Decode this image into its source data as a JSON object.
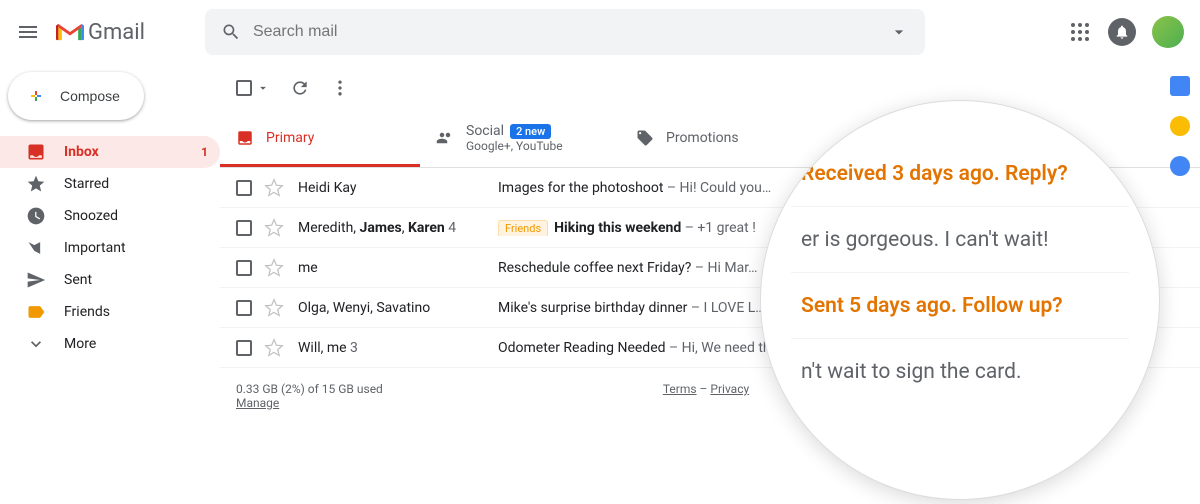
{
  "header": {
    "app_name": "Gmail",
    "search_placeholder": "Search mail"
  },
  "sidebar": {
    "compose_label": "Compose",
    "items": [
      {
        "label": "Inbox",
        "icon": "inbox",
        "active": true,
        "badge": "1"
      },
      {
        "label": "Starred",
        "icon": "star"
      },
      {
        "label": "Snoozed",
        "icon": "clock"
      },
      {
        "label": "Important",
        "icon": "important"
      },
      {
        "label": "Sent",
        "icon": "sent"
      },
      {
        "label": "Friends",
        "icon": "label"
      },
      {
        "label": "More",
        "icon": "more"
      }
    ]
  },
  "tabs": {
    "primary": {
      "label": "Primary"
    },
    "social": {
      "label": "Social",
      "new_count": "2 new",
      "sub": "Google+, YouTube"
    },
    "promotions": {
      "label": "Promotions"
    }
  },
  "emails": [
    {
      "sender": "Heidi Kay",
      "count": "",
      "label": "",
      "subject": "Images for the photoshoot",
      "snippet": " – Hi! Could you…",
      "bold": false
    },
    {
      "sender_html": "Meredith, <b>James</b>, <b>Karen</b>",
      "count": "4",
      "label": "Friends",
      "subject": "Hiking this weekend",
      "snippet": " – +1 great !",
      "bold": true
    },
    {
      "sender": "me",
      "count": "",
      "label": "",
      "subject": "Reschedule coffee next Friday?",
      "snippet": " – Hi Mar…",
      "bold": false
    },
    {
      "sender": "Olga, Wenyi, Savatino",
      "count": "",
      "label": "",
      "subject": "Mike's surprise birthday dinner",
      "snippet": " – I LOVE L…",
      "bold": false
    },
    {
      "sender": "Will, me",
      "count": "3",
      "label": "",
      "subject": "Odometer Reading Needed",
      "snippet": " – Hi, We need th…",
      "bold": false
    }
  ],
  "footer": {
    "storage": "0.33 GB (2%) of 15 GB used",
    "manage": "Manage",
    "terms": "Terms",
    "privacy": "Privacy"
  },
  "magnifier": {
    "nudge1": "Received 3 days ago. Reply?",
    "text1": "er is gorgeous.  I can't wait!",
    "nudge2": "Sent 5 days ago. Follow up?",
    "text2": "n't wait to sign the card."
  }
}
